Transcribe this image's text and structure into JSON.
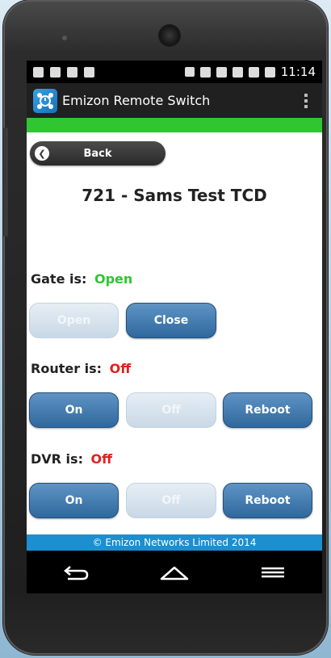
{
  "status_bar": {
    "time": "11:14",
    "left_icons": [
      "sim-icon",
      "image-icon",
      "lg-icon",
      "android-icon"
    ],
    "right_icons": [
      "nfc-icon",
      "volume-icon",
      "wifi-icon",
      "sim2-icon",
      "signal-icon",
      "battery-icon"
    ]
  },
  "app_bar": {
    "title": "Emizon Remote Switch",
    "menu_icon": "overflow-menu-icon"
  },
  "back_button": {
    "label": "Back",
    "icon": "chevron-left-icon"
  },
  "page_title": "721 - Sams Test TCD",
  "devices": {
    "gate": {
      "label": "Gate is:",
      "status": "Open",
      "buttons": {
        "open": "Open",
        "close": "Close"
      }
    },
    "router": {
      "label": "Router is:",
      "status": "Off",
      "buttons": {
        "on": "On",
        "off": "Off",
        "reboot": "Reboot"
      }
    },
    "dvr": {
      "label": "DVR is:",
      "status": "Off",
      "buttons": {
        "on": "On",
        "off": "Off",
        "reboot": "Reboot"
      }
    }
  },
  "footer": "© Emizon Networks Limited 2014",
  "nav": [
    "back-nav-icon",
    "home-nav-icon",
    "menu-nav-icon"
  ],
  "colors": {
    "accent_green": "#2fc632",
    "status_red": "#e02020",
    "button_blue": "#2f689e",
    "footer_blue": "#1b8fd0"
  }
}
